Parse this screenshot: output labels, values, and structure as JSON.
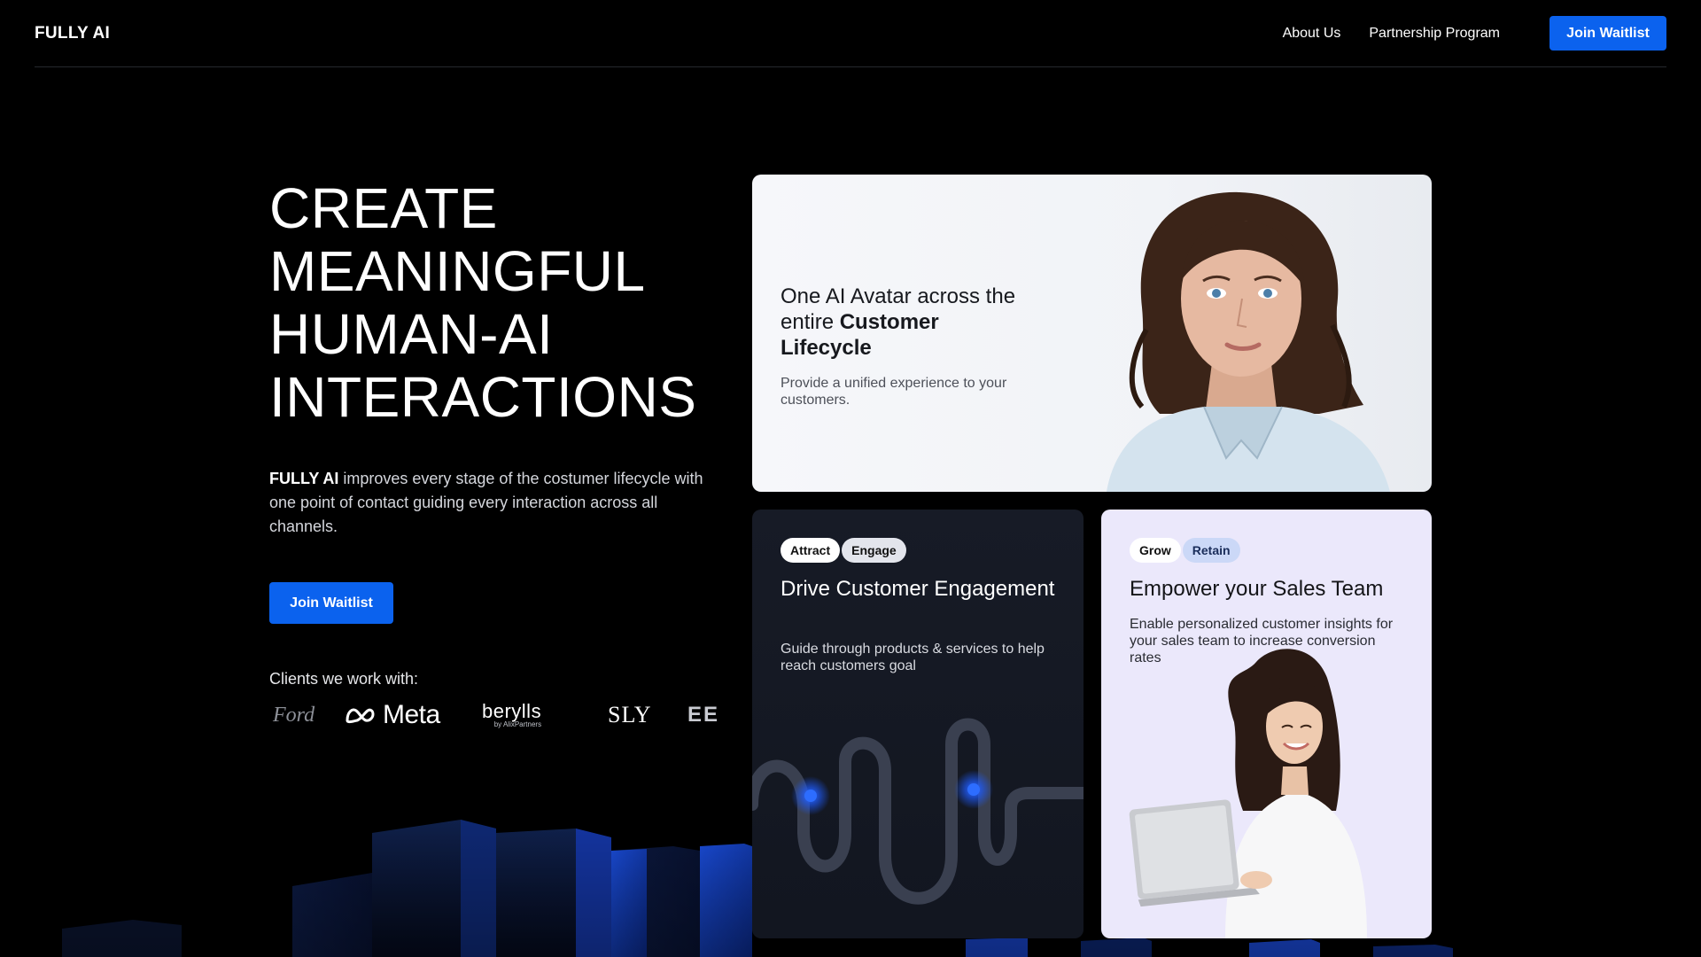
{
  "header": {
    "logo": "FULLY AI",
    "nav": [
      "About Us",
      "Partnership Program"
    ],
    "cta": "Join Waitlist"
  },
  "hero": {
    "title_lines": [
      "CREATE",
      "MEANINGFUL",
      "HUMAN-AI",
      "INTERACTIONS"
    ],
    "description_brand": "FULLY AI",
    "description_rest": " improves every stage of the costumer lifecycle with one point of contact guiding every interaction across all channels.",
    "cta": "Join Waitlist",
    "clients_label": "Clients we work with:",
    "client_logos": [
      "Ford",
      "Meta",
      "berylls",
      "SLY",
      "EE"
    ],
    "client_logo_sub": "by AlixPartners"
  },
  "cards": {
    "top": {
      "title_plain": "One AI Avatar across the entire ",
      "title_bold": "Customer Lifecycle",
      "description": "Provide a unified experience to your customers."
    },
    "engagement": {
      "tags": [
        "Attract",
        "Engage"
      ],
      "title": "Drive Customer Engagement",
      "description": "Guide through products & services to help reach customers goal"
    },
    "sales": {
      "tags": [
        "Grow",
        "Retain"
      ],
      "title": "Empower your Sales Team",
      "description": "Enable personalized customer insights for your sales team to increase conversion rates"
    }
  },
  "colors": {
    "accent": "#0b62ee",
    "background": "#000000",
    "card_dark": "#141823",
    "card_light": "#ebe8fb"
  }
}
